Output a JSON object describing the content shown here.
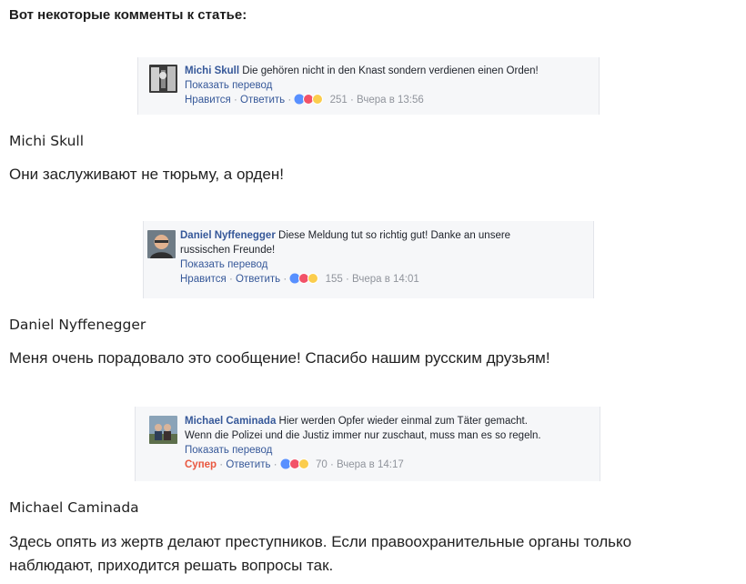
{
  "heading": "Вот некоторые комменты к статье:",
  "comments": [
    {
      "author": "Michi Skull",
      "text": "Die gehören nicht in den Knast sondern verdienen einen Orden!",
      "translate_label": "Показать перевод",
      "like_label": "Нравится",
      "reply_label": "Ответить",
      "separator": "·",
      "reaction_count": "251",
      "time": "Вчера в 13:56",
      "reaction_icons": [
        "like-icon",
        "love-icon",
        "haha-icon"
      ],
      "caption_name": "Michi Skull",
      "caption_text": "Они заслуживают не тюрьму, а орден!"
    },
    {
      "author": "Daniel Nyffenegger",
      "text": "Diese Meldung tut so richtig gut! Danke an unsere russischen Freunde!",
      "text_line1": "Diese Meldung tut so richtig gut! Danke an unsere",
      "text_line2": "russischen Freunde!",
      "translate_label": "Показать перевод",
      "like_label": "Нравится",
      "reply_label": "Ответить",
      "separator": "·",
      "reaction_count": "155",
      "time": "Вчера в 14:01",
      "reaction_icons": [
        "like-icon",
        "love-icon",
        "haha-icon"
      ],
      "caption_name": "Daniel Nyffenegger",
      "caption_text": "Меня очень порадовало это сообщение! Спасибо нашим русским друзьям!"
    },
    {
      "author": "Michael Caminada",
      "text_line1": "Hier werden Opfer wieder einmal zum Täter gemacht.",
      "text_line2": "Wenn die Polizei und die Justiz immer nur zuschaut, muss man es so regeln.",
      "translate_label": "Показать перевод",
      "like_label": "Супер",
      "reply_label": "Ответить",
      "separator": "·",
      "reaction_count": "70",
      "time": "Вчера в 14:17",
      "reaction_icons": [
        "like-icon",
        "love-icon",
        "haha-icon"
      ],
      "caption_name": "Michael Caminada",
      "caption_text": "Здесь опять из жертв делают преступников. Если правоохранительные органы только наблюдают, приходится решать вопросы так."
    }
  ],
  "colors": {
    "link": "#365899",
    "meta": "#90949c",
    "super": "#e9573f",
    "card_bg": "#f6f7f9"
  }
}
